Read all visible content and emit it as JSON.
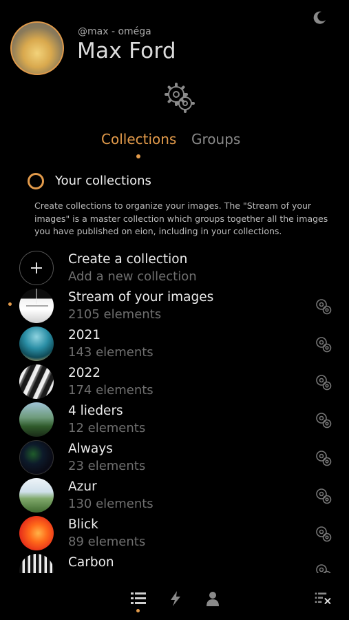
{
  "profile": {
    "handle": "@max - oméga",
    "name": "Max Ford"
  },
  "tabs": [
    {
      "label": "Collections",
      "active": true
    },
    {
      "label": "Groups",
      "active": false
    }
  ],
  "section": {
    "title": "Your collections",
    "description": "Create collections to organize your images. The \"Stream of your images\" is a master collection which groups together all the images you have published on eion, including in your collections."
  },
  "create": {
    "title": "Create a collection",
    "subtitle": "Add a new collection"
  },
  "collections": [
    {
      "title": "Stream of your images",
      "count": "2105 elements",
      "selected": true
    },
    {
      "title": "2021",
      "count": "143 elements"
    },
    {
      "title": "2022",
      "count": "174 elements"
    },
    {
      "title": "4 lieders",
      "count": "12 elements"
    },
    {
      "title": "Always",
      "count": "23 elements"
    },
    {
      "title": "Azur",
      "count": "130 elements"
    },
    {
      "title": "Blick",
      "count": "89 elements"
    },
    {
      "title": "Carbon",
      "count": ""
    }
  ],
  "colors": {
    "accent": "#e39b4b",
    "background": "#000000",
    "muted_text": "#6f6f6f"
  },
  "nav": {
    "icons": [
      "list-icon",
      "lightning-icon",
      "person-icon",
      "list-close-icon"
    ],
    "active": "list-icon"
  }
}
